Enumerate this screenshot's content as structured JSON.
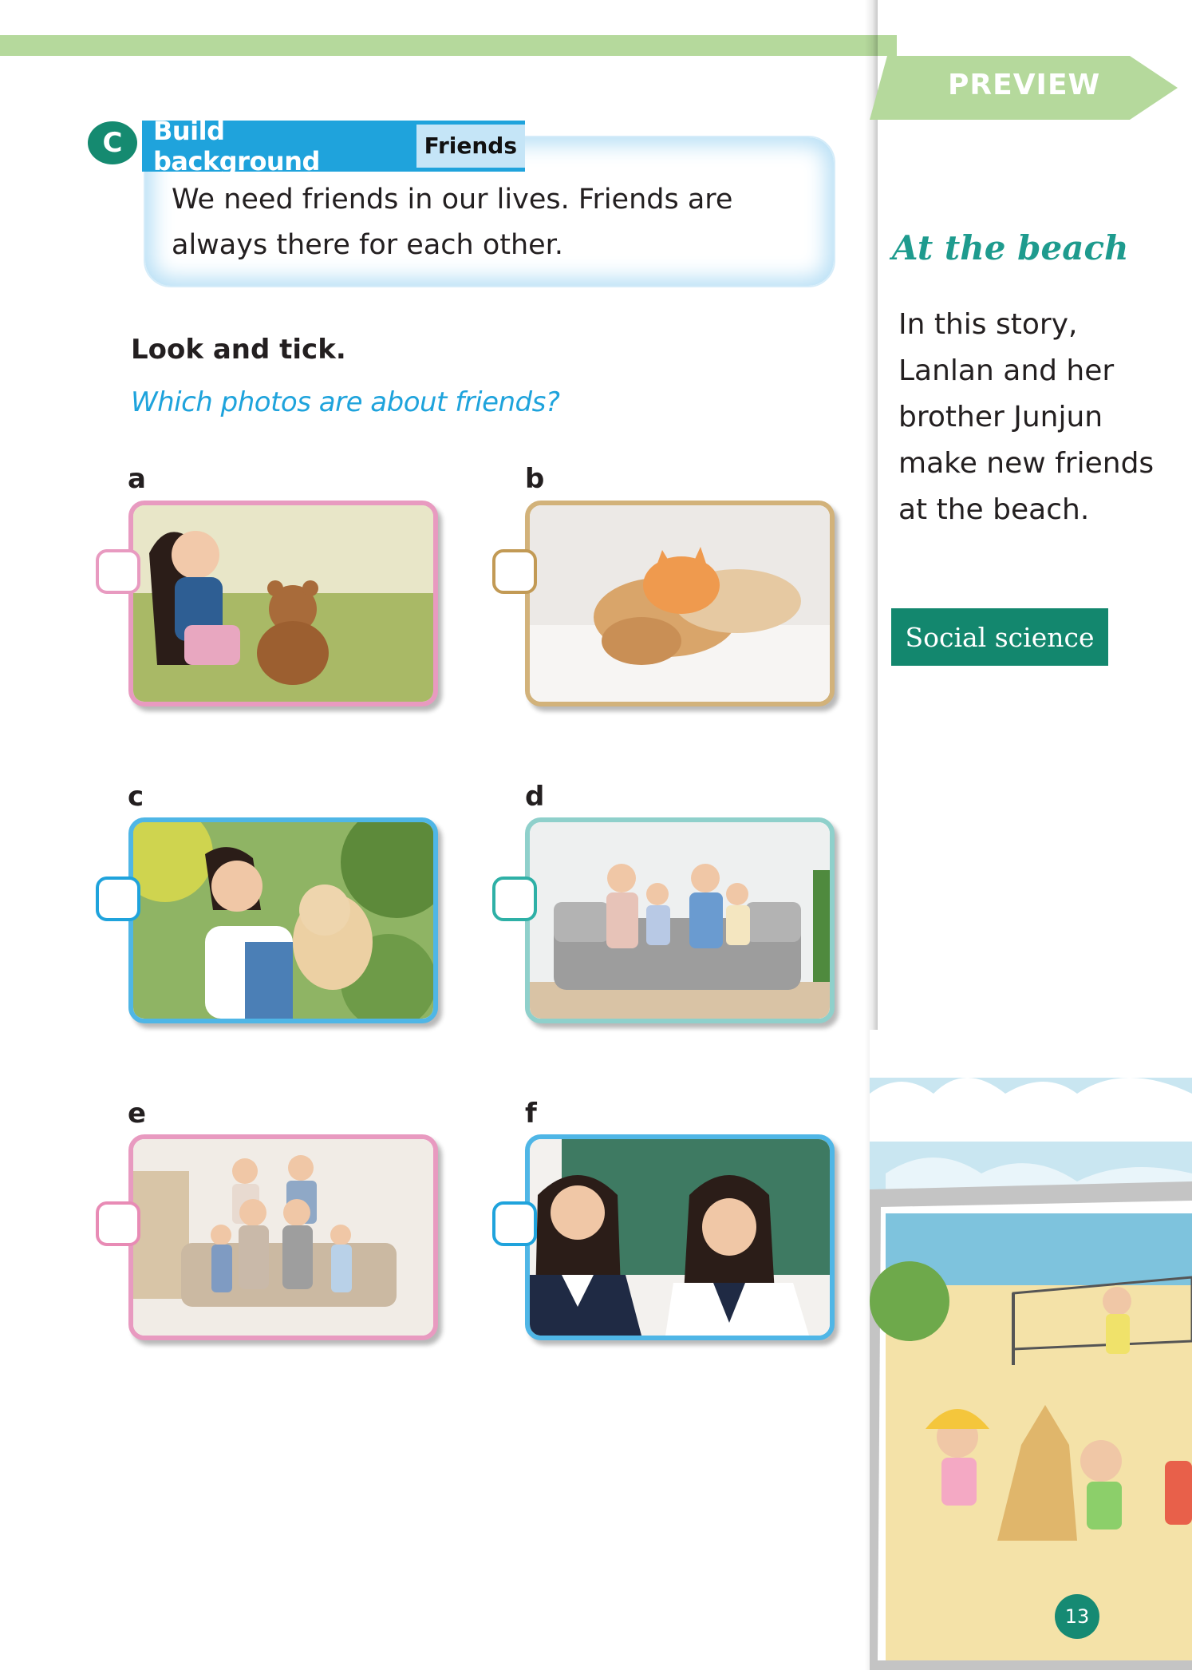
{
  "preview": {
    "label": "PREVIEW"
  },
  "section": {
    "letter": "C",
    "title": "Build background",
    "topic": "Friends",
    "text": "We need friends in our lives. Friends are always there for each other."
  },
  "activity": {
    "instruction": "Look and tick.",
    "question": "Which photos are about friends?"
  },
  "photos": [
    {
      "label": "a",
      "subject": "girl-with-teddy-bear",
      "frame_color": "#e89ac0",
      "checked": false
    },
    {
      "label": "b",
      "subject": "puppy-and-kitten",
      "frame_color": "#d2b27a",
      "checked": false
    },
    {
      "label": "c",
      "subject": "girl-with-puppy",
      "frame_color": "#4fb6e6",
      "checked": false
    },
    {
      "label": "d",
      "subject": "family-on-sofa",
      "frame_color": "#8fd0cb",
      "checked": false
    },
    {
      "label": "e",
      "subject": "grandparents-and-family",
      "frame_color": "#e89ac0",
      "checked": false
    },
    {
      "label": "f",
      "subject": "schoolgirls-in-classroom",
      "frame_color": "#4fb6e6",
      "checked": false
    }
  ],
  "sidebar": {
    "story_title": "At the beach",
    "story_text": "In this story, Lanlan and her brother Junjun make new friends at the beach.",
    "subject": "Social science",
    "illustration": "children-playing-at-beach"
  },
  "page_number": "13",
  "colors": {
    "accent_green": "#b5d99c",
    "teal": "#158a70",
    "blue": "#1fa3dc",
    "pink_frame": "#e89ac0",
    "tan_frame": "#d2b27a",
    "blue_frame": "#4fb6e6",
    "teal_frame": "#8fd0cb"
  }
}
